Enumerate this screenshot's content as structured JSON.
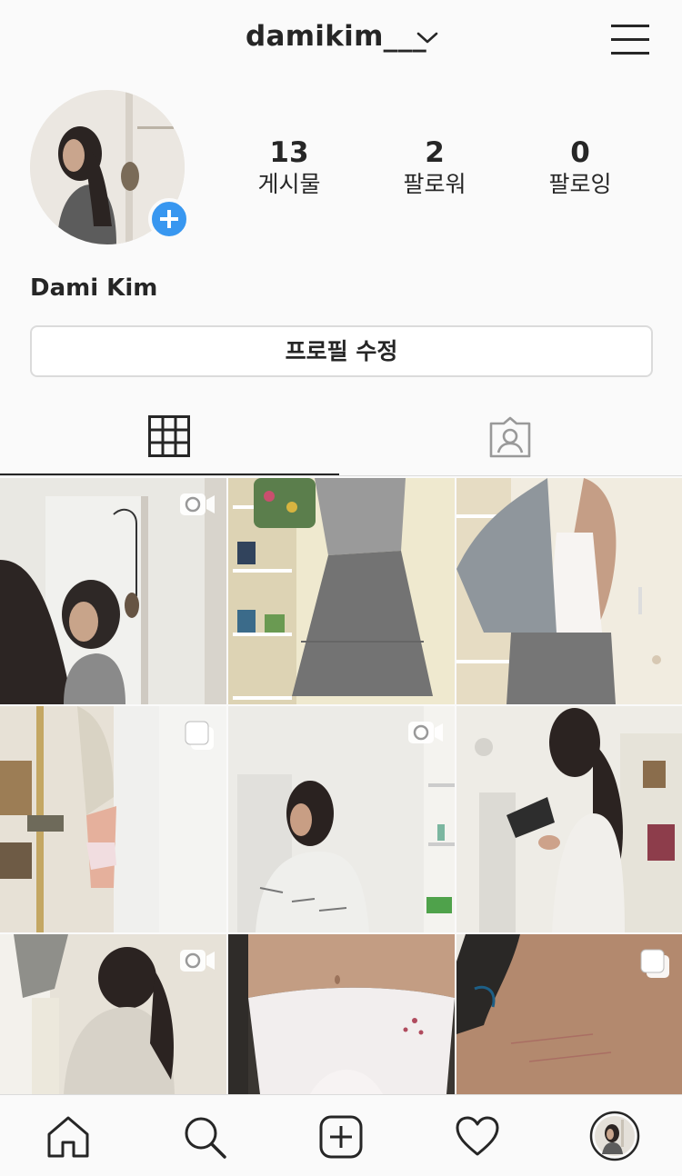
{
  "header": {
    "username": "damikim___"
  },
  "profile": {
    "full_name": "Dami Kim",
    "stats": [
      {
        "count": "13",
        "label": "게시물"
      },
      {
        "count": "2",
        "label": "팔로워"
      },
      {
        "count": "0",
        "label": "팔로잉"
      }
    ],
    "edit_profile_label": "프로필 수정"
  },
  "tabs": [
    {
      "icon": "grid-icon",
      "active": true
    },
    {
      "icon": "tagged-person-icon",
      "active": false
    }
  ],
  "posts": [
    {
      "media": "video"
    },
    {
      "media": "photo"
    },
    {
      "media": "photo"
    },
    {
      "media": "carousel"
    },
    {
      "media": "video"
    },
    {
      "media": "photo"
    },
    {
      "media": "video"
    },
    {
      "media": "photo"
    },
    {
      "media": "carousel"
    }
  ],
  "bottom_nav": [
    "home-icon",
    "search-icon",
    "new-post-icon",
    "activity-heart-icon",
    "profile-avatar-icon"
  ],
  "colors": {
    "accent": "#3897f0",
    "text": "#262626",
    "border": "#dbdbdb",
    "background": "#fafafa"
  }
}
